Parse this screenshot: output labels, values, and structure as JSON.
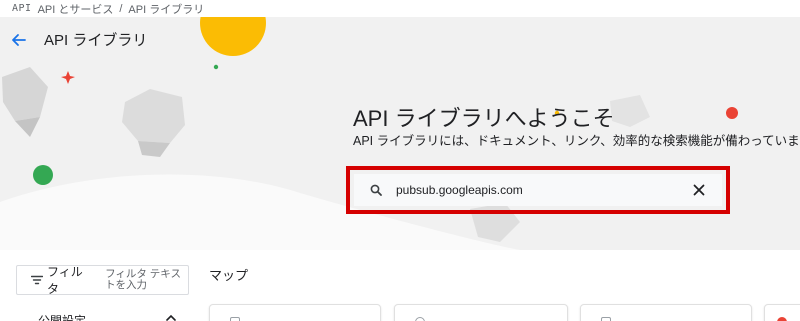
{
  "breadcrumb": {
    "api_icon_text": "API",
    "parent": "API とサービス",
    "separator": "/",
    "current": "API ライブラリ"
  },
  "header": {
    "back_icon": "arrow-back-icon",
    "title": "API ライブラリ"
  },
  "hero": {
    "title": "API ライブラリへようこそ",
    "subtitle": "API ライブラリには、ドキュメント、リンク、効率的な検索機能が備わっています。",
    "search": {
      "value": "pubsub.googleapis.com",
      "placeholder": "",
      "clear_icon": "close-icon",
      "search_icon": "search-icon"
    }
  },
  "filter": {
    "label": "フィルタ",
    "placeholder": "フィルタ テキストを入力",
    "icon": "filter-icon"
  },
  "main": {
    "section_title": "マップ"
  },
  "sidebar": {
    "visibility_label": "公開設定"
  },
  "colors": {
    "accent": "#1a73e8",
    "highlight": "#d50000",
    "yellow": "#fbbc04",
    "green": "#34a853",
    "red": "#ea4335"
  }
}
